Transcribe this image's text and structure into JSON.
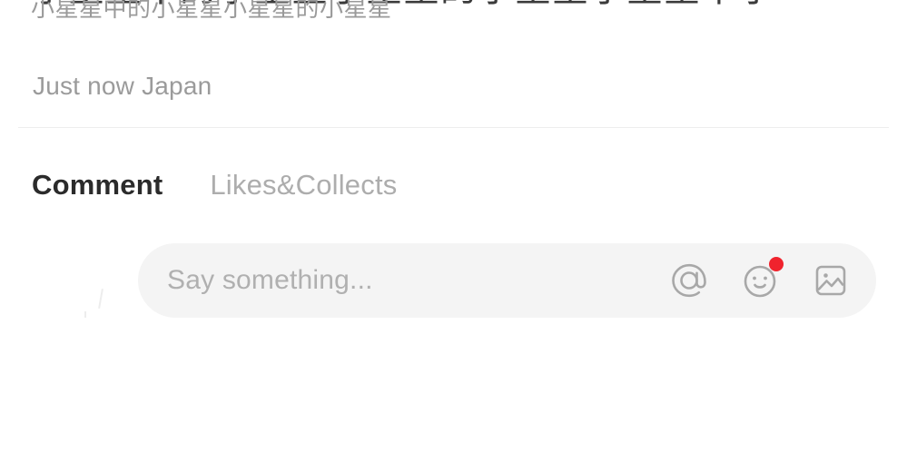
{
  "top_clipped": {
    "line1": "小星星中的小星星小星星的小星星小星星中小",
    "line2": "小星星中的小星星小星星的小星星"
  },
  "post_meta": {
    "timestamp": "Just now",
    "location": "Japan",
    "text": "Just now Japan"
  },
  "tabs": [
    {
      "label": "Comment",
      "active": true
    },
    {
      "label": "Likes&Collects",
      "active": false
    }
  ],
  "composer": {
    "placeholder": "Say something...",
    "value": "",
    "actions": [
      {
        "name": "mention-icon",
        "label": "@",
        "badge": false
      },
      {
        "name": "emoji-icon",
        "label": "Emoji",
        "badge": true
      },
      {
        "name": "image-icon",
        "label": "Image",
        "badge": false
      }
    ]
  },
  "colors": {
    "background": "#ffffff",
    "divider": "#ededed",
    "pill_background": "#f4f4f4",
    "text_primary": "#2b2b2b",
    "text_muted": "#9b9b9b",
    "text_placeholder": "#b0b0b0",
    "icon_stroke": "#a8a8a8",
    "badge_red": "#f0232d"
  }
}
